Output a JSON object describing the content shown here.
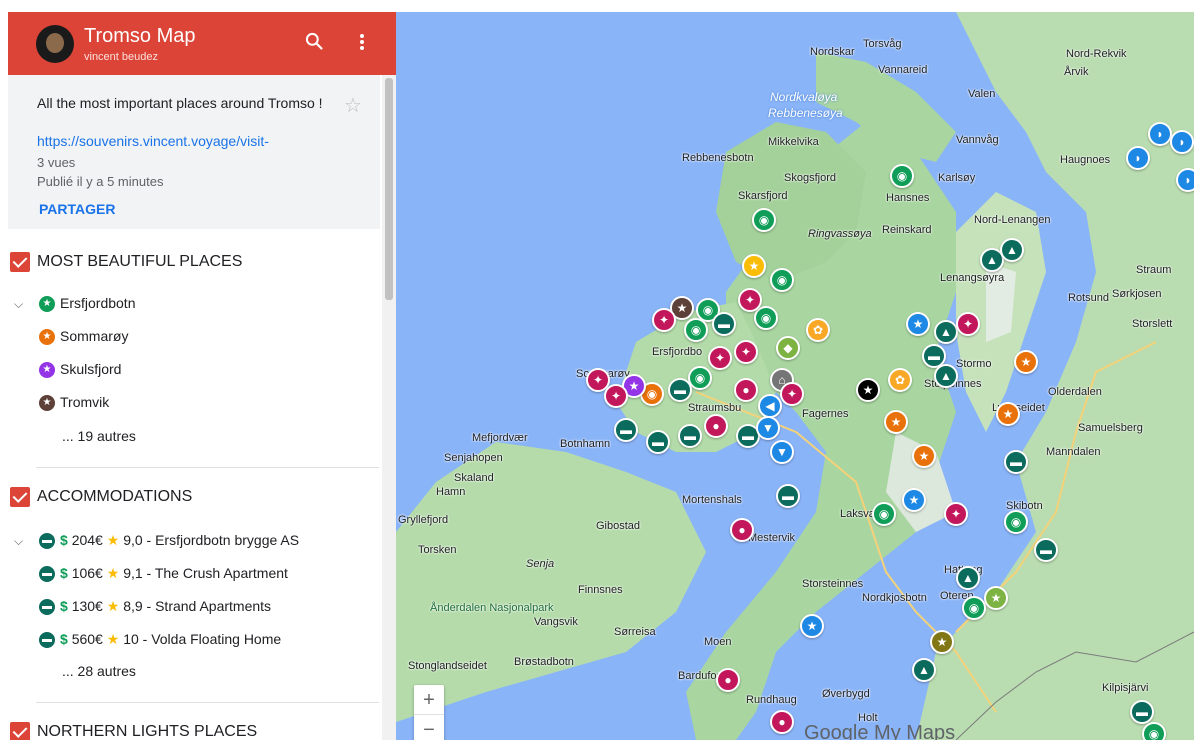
{
  "header": {
    "title": "Tromso Map",
    "author": "vincent beudez"
  },
  "info": {
    "description": "All the most important places around Tromso !",
    "link": "https://souvenirs.vincent.voyage/visit-",
    "views": "3 vues",
    "published": "Publié il y a 5 minutes",
    "share_label": "PARTAGER"
  },
  "layers": [
    {
      "title": "MOST BEAUTIFUL PLACES",
      "items": [
        {
          "label": "Ersfjordbotn",
          "color": "#0f9d58",
          "icon": "star-icon"
        },
        {
          "label": "Sommarøy",
          "color": "#e8710a",
          "icon": "star-icon"
        },
        {
          "label": "Skulsfjord",
          "color": "#9334e6",
          "icon": "star-icon"
        },
        {
          "label": "Tromvik",
          "color": "#5d4037",
          "icon": "star-icon"
        }
      ],
      "more": "... 19 autres"
    },
    {
      "title": "ACCOMMODATIONS",
      "items": [
        {
          "price": "$",
          "amount": "204€",
          "rating_star": "★",
          "label": "9,0 - Ersfjordbotn brygge AS",
          "color": "#0b6b5c",
          "icon": "bed-icon"
        },
        {
          "price": "$",
          "amount": "106€",
          "rating_star": "★",
          "label": "9,1 - The Crush Apartment",
          "color": "#0b6b5c",
          "icon": "bed-icon"
        },
        {
          "price": "$",
          "amount": "130€",
          "rating_star": "★",
          "label": "8,9 - Strand Apartments",
          "color": "#0b6b5c",
          "icon": "bed-icon"
        },
        {
          "price": "$",
          "amount": "560€",
          "rating_star": "★",
          "label": "10 - Volda Floating Home",
          "color": "#0b6b5c",
          "icon": "bed-icon"
        }
      ],
      "more": "... 28 autres"
    },
    {
      "title": "NORTHERN LIGHTS PLACES"
    }
  ],
  "map": {
    "places": [
      "Nordskar",
      "Torsvåg",
      "Vannareid",
      "Nord-Rekvik",
      "Årvik",
      "Valen",
      "Nordkvaløya",
      "Rebbenesøya",
      "Mikkelvika",
      "Vannvåg",
      "Rebbenesbotn",
      "Haugnoes",
      "Skogsfjord",
      "Karlsøy",
      "Skarsfjord",
      "Hansnes",
      "Ringvassøya",
      "Reinskard",
      "Nord-Lenangen",
      "Lenangsøyra",
      "Rotsund",
      "Sørkjosen",
      "Storslett",
      "Ersfjordbo",
      "Sommarøy",
      "Straumsbu",
      "Fagernes",
      "Olderdalen",
      "Mefjordvær",
      "Botnhamn",
      "Senjahopen",
      "Skaland",
      "Hamn",
      "Samuelsberg",
      "Manndalen",
      "Mortenshals",
      "Gryllefjord",
      "Gibostad",
      "Laksvatn",
      "Skibotn",
      "Torsken",
      "Mestervik",
      "Senja",
      "Finnsnes",
      "Storsteinnes",
      "Nordkjosbotn",
      "Oteren",
      "Ånderdalen Nasjonalpark",
      "Vangsvik",
      "Sørreisa",
      "Moen",
      "Stonglandseidet",
      "Brøstadbotn",
      "Bardufoss",
      "Rundhaug",
      "Øverbygd",
      "Holt",
      "Kilpisjärvi",
      "Hatteng",
      "Lyngseidet",
      "Stormo",
      "Stolpeinnes",
      "Straum"
    ],
    "zoom_in": "+",
    "zoom_out": "−",
    "attribution": "Google My Maps"
  }
}
